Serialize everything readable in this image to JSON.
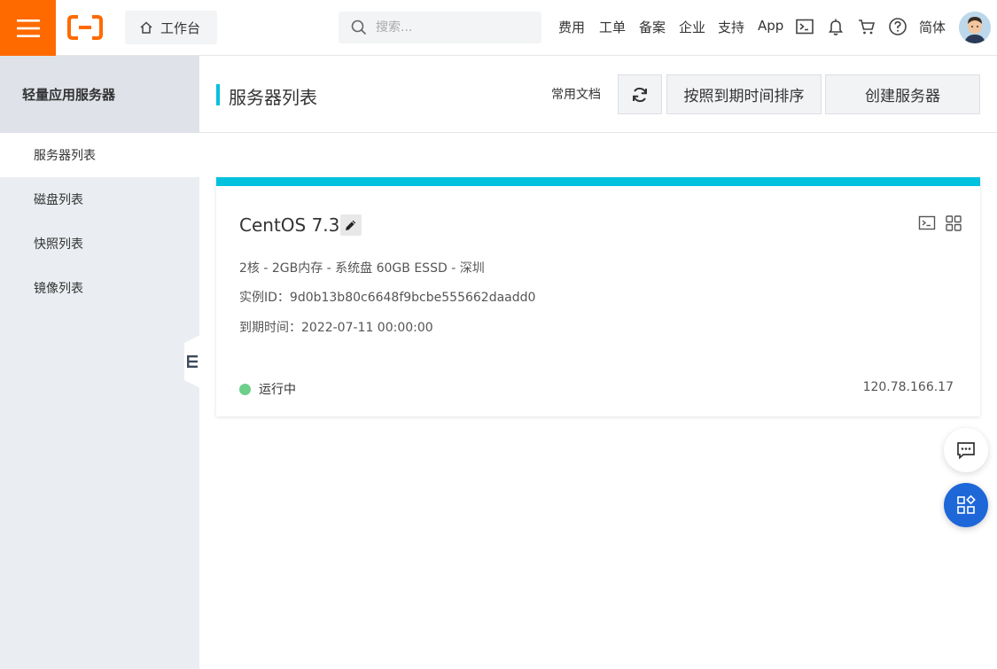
{
  "colors": {
    "brand": "#ff6a00",
    "accent": "#00c1de",
    "status_running": "#6ccf8a",
    "float_primary": "#1e67d9"
  },
  "topbar": {
    "workbench_label": "工作台",
    "search_placeholder": "搜索...",
    "nav_links": [
      "费用",
      "工单",
      "备案",
      "企业",
      "支持",
      "App"
    ],
    "lang_label": "简体"
  },
  "sidebar": {
    "title": "轻量应用服务器",
    "items": [
      {
        "label": "服务器列表",
        "active": true
      },
      {
        "label": "磁盘列表",
        "active": false
      },
      {
        "label": "快照列表",
        "active": false
      },
      {
        "label": "镜像列表",
        "active": false
      }
    ]
  },
  "main": {
    "page_title": "服务器列表",
    "doc_link": "常用文档",
    "sort_button": "按照到期时间排序",
    "create_button": "创建服务器"
  },
  "server_card": {
    "name": "CentOS 7.3",
    "spec": "2核 - 2GB内存 - 系统盘 60GB ESSD - 深圳",
    "instance_id": "实例ID：9d0b13b80c6648f9bcbe555662daadd0",
    "expire_time": "到期时间：2022-07-11 00:00:00",
    "status": "运行中",
    "ip": "120.78.166.17"
  }
}
